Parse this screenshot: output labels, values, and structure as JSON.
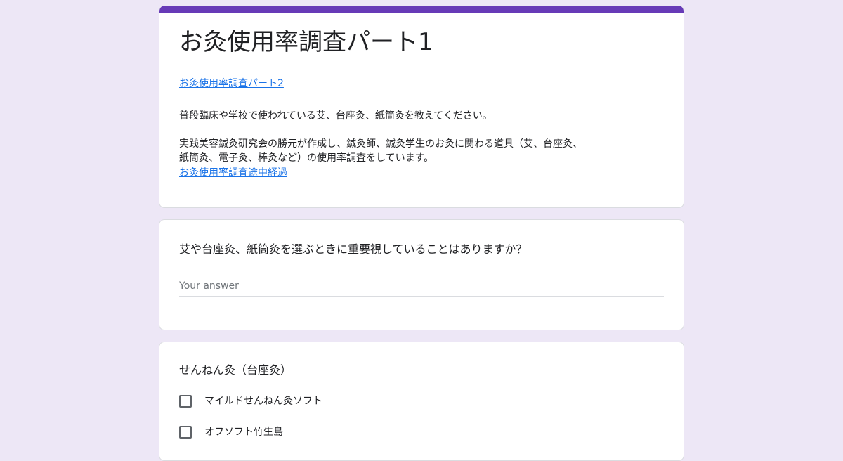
{
  "form": {
    "title": "お灸使用率調査パート1",
    "part2_link": "お灸使用率調査パート2",
    "description_1": "普段臨床や学校で使われている艾、台座灸、紙筒灸を教えてください。",
    "description_2a": "実践美容鍼灸研究会の勝元が作成し、鍼灸師、鍼灸学生のお灸に関わる道具（艾、台座灸、",
    "description_2b": "紙筒灸、電子灸、棒灸など）の使用率調査をしています。",
    "progress_link": "お灸使用率調査途中経過",
    "accent_color": "#673ab7"
  },
  "question_1": {
    "text": "艾や台座灸、紙筒灸を選ぶときに重要視していることはありますか？",
    "placeholder": "Your answer"
  },
  "question_2": {
    "text": "せんねん灸（台座灸）",
    "options": [
      {
        "label": "マイルドせんねん灸ソフト"
      },
      {
        "label": "オフソフト竹生島"
      }
    ]
  }
}
